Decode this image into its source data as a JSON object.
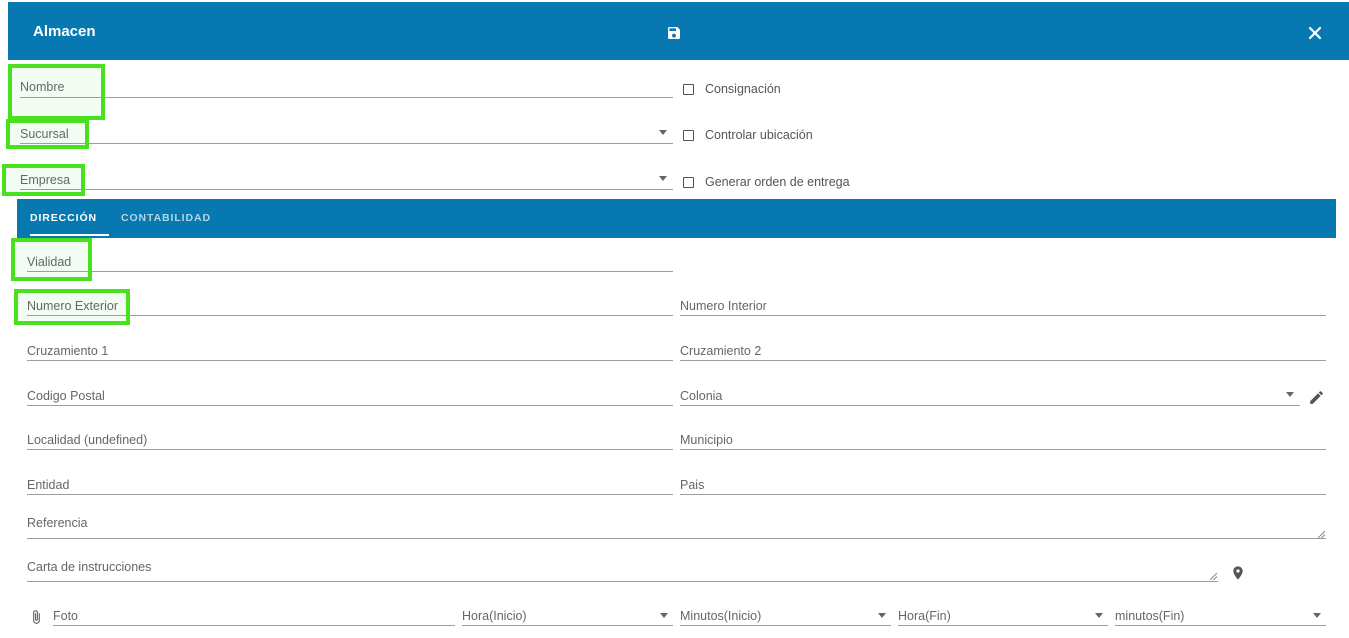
{
  "header": {
    "title": "Almacen",
    "save_icon": "floppy-disk-icon",
    "close_icon": "close-icon",
    "bg_color": "#0779b0"
  },
  "top_fields": {
    "nombre": {
      "label": "Nombre",
      "value": ""
    },
    "sucursal": {
      "label": "Sucursal",
      "value": ""
    },
    "empresa": {
      "label": "Empresa",
      "value": ""
    }
  },
  "checkboxes": {
    "consignacion": {
      "label": "Consignación",
      "checked": false
    },
    "controlar_ubicacion": {
      "label": "Controlar ubicación",
      "checked": false
    },
    "generar_orden": {
      "label": "Generar orden de entrega",
      "checked": false
    }
  },
  "tabs": [
    {
      "label": "DIRECCIÓN",
      "active": true
    },
    {
      "label": "CONTABILIDAD",
      "active": false
    }
  ],
  "direccion": {
    "vialidad": "Vialidad",
    "numero_exterior": "Numero Exterior",
    "numero_interior": "Numero Interior",
    "cruzamiento1": "Cruzamiento 1",
    "cruzamiento2": "Cruzamiento 2",
    "codigo_postal": "Codigo Postal",
    "colonia": "Colonia",
    "localidad": "Localidad (undefined)",
    "municipio": "Municipio",
    "entidad": "Entidad",
    "pais": "Pais",
    "referencia": "Referencia",
    "carta": "Carta de instrucciones"
  },
  "bottom_row": {
    "foto": "Foto",
    "hora_inicio": "Hora(Inicio)",
    "minutos_inicio": "Minutos(Inicio)",
    "hora_fin": "Hora(Fin)",
    "minutos_fin": "minutos(Fin)"
  },
  "icons": {
    "edit": "pencil-icon",
    "location": "map-pin-icon",
    "attach": "paperclip-icon"
  },
  "highlight_color": "#49e020"
}
